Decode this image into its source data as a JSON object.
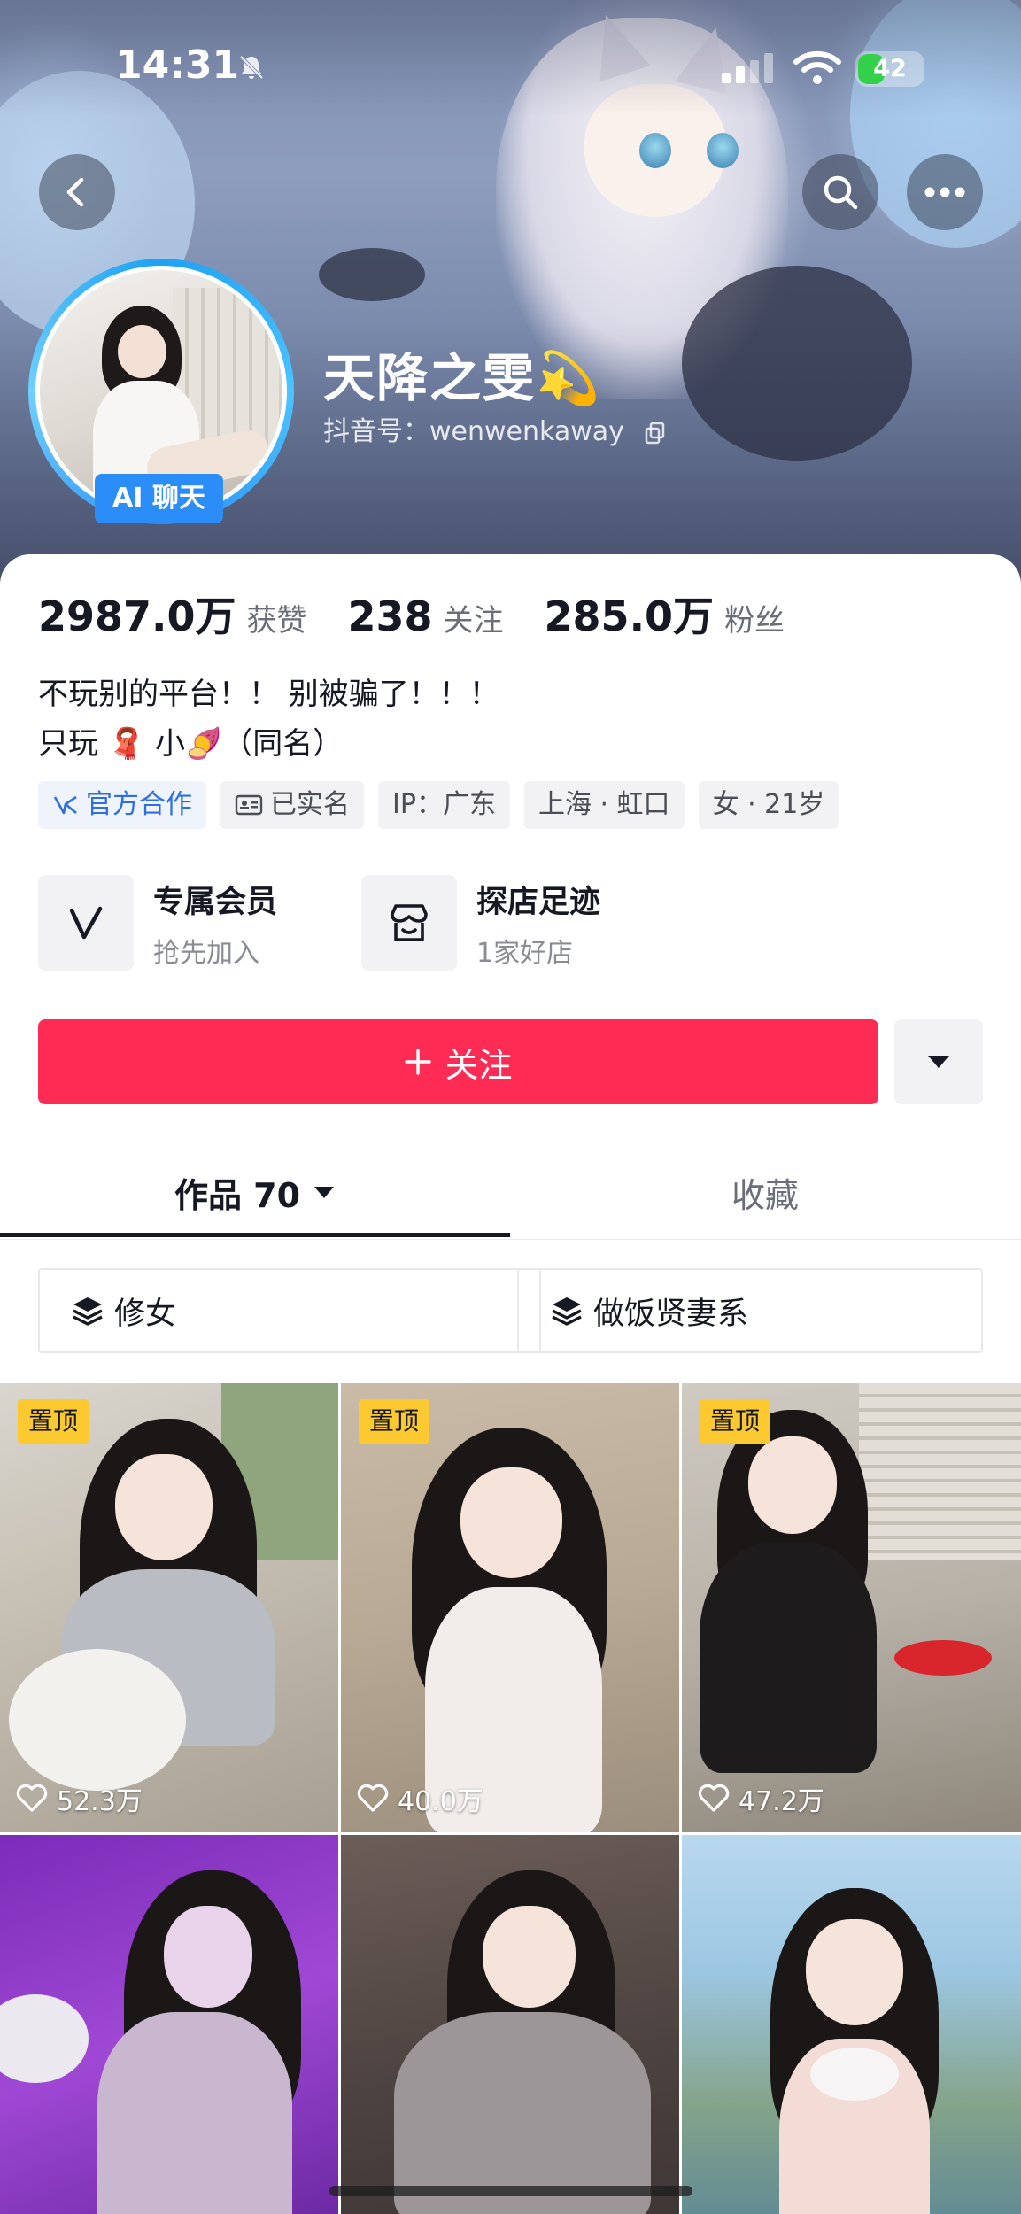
{
  "status_bar": {
    "time": "14:31",
    "battery": "42",
    "battery_level_percent": 42
  },
  "colors": {
    "primary_red": "#fe2c55",
    "ai_blue": "#2b8df8",
    "pin_yellow": "#fcc931",
    "official_blue": "#2d6fe0"
  },
  "profile": {
    "nickname": "天降之雯💫",
    "douyin_id": "抖音号：wenwenkaway",
    "ai_chat_label": "AI 聊天"
  },
  "stats": [
    {
      "value": "2987.0万",
      "label": "获赞"
    },
    {
      "value": "238",
      "label": "关注"
    },
    {
      "value": "285.0万",
      "label": "粉丝"
    }
  ],
  "bio": {
    "line1": "不玩别的平台！！ 别被骗了！！！",
    "line2": "只玩 🧣 小🍠（同名）"
  },
  "tags": [
    {
      "label": "官方合作",
      "icon": "official-icon"
    },
    {
      "label": "已实名",
      "icon": "id-card-icon"
    },
    {
      "label": "IP：广东"
    },
    {
      "label": "上海 · 虹口"
    },
    {
      "label": "女 · 21岁"
    }
  ],
  "features": [
    {
      "title": "专属会员",
      "subtitle": "抢先加入",
      "icon": "v-member-icon"
    },
    {
      "title": "探店足迹",
      "subtitle": "1家好店",
      "icon": "shop-icon"
    }
  ],
  "follow_button": {
    "label": "关注",
    "icon": "plus-icon"
  },
  "tabs": {
    "works_label": "作品 70",
    "favorites_label": "收藏"
  },
  "collections": [
    {
      "label": "修女",
      "icon": "layers-icon"
    },
    {
      "label": "做饭贤妻系",
      "icon": "layers-icon"
    }
  ],
  "videos": [
    {
      "pinned": "置顶",
      "likes": "52.3万"
    },
    {
      "pinned": "置顶",
      "likes": "40.0万"
    },
    {
      "pinned": "置顶",
      "likes": "47.2万"
    },
    {
      "pinned": "",
      "likes": ""
    },
    {
      "pinned": "",
      "likes": ""
    },
    {
      "pinned": "",
      "likes": ""
    }
  ]
}
